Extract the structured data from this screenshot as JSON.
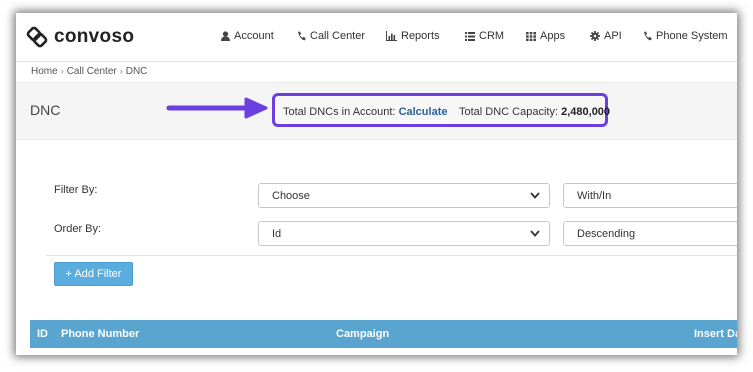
{
  "brand": {
    "name": "convoso"
  },
  "nav": [
    {
      "label": "Account",
      "icon": "user-icon"
    },
    {
      "label": "Call Center",
      "icon": "phone-icon"
    },
    {
      "label": "Reports",
      "icon": "bar-chart-icon"
    },
    {
      "label": "CRM",
      "icon": "list-icon"
    },
    {
      "label": "Apps",
      "icon": "grid-icon"
    },
    {
      "label": "API",
      "icon": "gear-icon"
    },
    {
      "label": "Phone System",
      "icon": "phone-icon"
    }
  ],
  "breadcrumb": [
    "Home",
    "Call Center",
    "DNC"
  ],
  "page": {
    "title": "DNC"
  },
  "stats": {
    "total_label": "Total DNCs in Account:",
    "total_link": "Calculate",
    "capacity_label": "Total DNC Capacity:",
    "capacity_value": "2,480,000"
  },
  "filters": {
    "filter_by_label": "Filter By:",
    "filter_by_value": "Choose",
    "filter_op_value": "With/In",
    "order_by_label": "Order By:",
    "order_by_value": "Id",
    "order_dir_value": "Descending",
    "add_filter_label": "+ Add Filter"
  },
  "table": {
    "columns": [
      "ID",
      "Phone Number",
      "Campaign",
      "Insert Da"
    ]
  },
  "colors": {
    "highlight": "#6b3fe0",
    "table_header": "#5aa5cf",
    "button": "#5bacdf",
    "link": "#2e5f9e"
  }
}
